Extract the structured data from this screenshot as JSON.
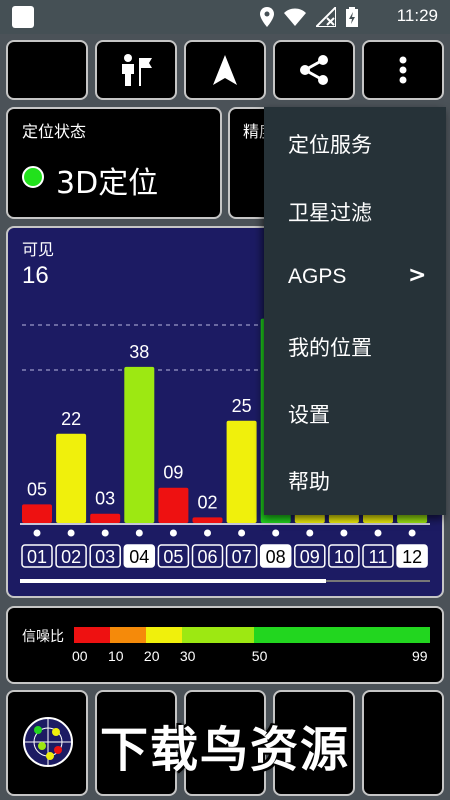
{
  "status_bar": {
    "time": "11:29"
  },
  "toolbar": {
    "icons": [
      "night-mode-icon",
      "person-flag-icon",
      "navigation-icon",
      "share-icon",
      "more-vert-icon"
    ]
  },
  "fix_panel": {
    "title": "定位状态",
    "status": "3D定位",
    "status_color": "#22e11c"
  },
  "precision_panel": {
    "title_partial": "精度"
  },
  "visible": {
    "label": "可见",
    "count": "16"
  },
  "chart_data": {
    "type": "bar",
    "categories": [
      "01",
      "02",
      "03",
      "04",
      "05",
      "06",
      "07",
      "08",
      "09",
      "10",
      "11",
      "12"
    ],
    "bars": [
      {
        "prn": "05",
        "snr": 10,
        "color": "#ee1111"
      },
      {
        "prn": "22",
        "snr": 48,
        "color": "#f0f00c"
      },
      {
        "prn": "03",
        "snr": 5,
        "color": "#ee1111"
      },
      {
        "prn": "38",
        "snr": 84,
        "color": "#9de812"
      },
      {
        "prn": "09",
        "snr": 19,
        "color": "#ee1111"
      },
      {
        "prn": "02",
        "snr": 3,
        "color": "#ee1111"
      },
      {
        "prn": "25",
        "snr": 55,
        "color": "#f0f00c"
      },
      {
        "prn": "",
        "snr": 110,
        "color": "#22d61f"
      },
      {
        "prn": "",
        "snr": 5,
        "color": "#f0f00c"
      },
      {
        "prn": "",
        "snr": 5,
        "color": "#f0f00c"
      },
      {
        "prn": "",
        "snr": 5,
        "color": "#f0f00c"
      },
      {
        "prn": "",
        "snr": 5,
        "color": "#9de812"
      }
    ],
    "highlighted": [
      "04",
      "08",
      "12"
    ],
    "ylim": [
      0,
      120
    ]
  },
  "menu": {
    "items": [
      "定位服务",
      "卫星过滤",
      "AGPS",
      "我的位置",
      "设置",
      "帮助"
    ],
    "submenu_arrow": ">"
  },
  "snr_legend": {
    "label": "信噪比",
    "ticks": [
      "00",
      "10",
      "20",
      "30",
      "50",
      "99"
    ],
    "segments": [
      {
        "from": 0,
        "to": 10,
        "color": "#ee1111"
      },
      {
        "from": 10,
        "to": 20,
        "color": "#f58a0a"
      },
      {
        "from": 20,
        "to": 30,
        "color": "#f0f00c"
      },
      {
        "from": 30,
        "to": 50,
        "color": "#9de812"
      },
      {
        "from": 50,
        "to": 99,
        "color": "#22d61f"
      }
    ]
  },
  "watermark": {
    "text": "下载鸟资源"
  }
}
